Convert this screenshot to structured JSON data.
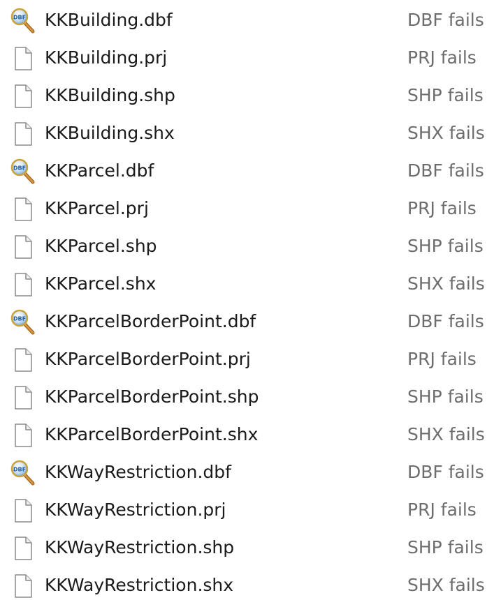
{
  "files": [
    {
      "name": "KKBuilding.dbf",
      "type": "DBF fails",
      "icon": "dbf-viewer-icon"
    },
    {
      "name": "KKBuilding.prj",
      "type": "PRJ fails",
      "icon": "blank-file-icon"
    },
    {
      "name": "KKBuilding.shp",
      "type": "SHP fails",
      "icon": "blank-file-icon"
    },
    {
      "name": "KKBuilding.shx",
      "type": "SHX fails",
      "icon": "blank-file-icon"
    },
    {
      "name": "KKParcel.dbf",
      "type": "DBF fails",
      "icon": "dbf-viewer-icon"
    },
    {
      "name": "KKParcel.prj",
      "type": "PRJ fails",
      "icon": "blank-file-icon"
    },
    {
      "name": "KKParcel.shp",
      "type": "SHP fails",
      "icon": "blank-file-icon"
    },
    {
      "name": "KKParcel.shx",
      "type": "SHX fails",
      "icon": "blank-file-icon"
    },
    {
      "name": "KKParcelBorderPoint.dbf",
      "type": "DBF fails",
      "icon": "dbf-viewer-icon"
    },
    {
      "name": "KKParcelBorderPoint.prj",
      "type": "PRJ fails",
      "icon": "blank-file-icon"
    },
    {
      "name": "KKParcelBorderPoint.shp",
      "type": "SHP fails",
      "icon": "blank-file-icon"
    },
    {
      "name": "KKParcelBorderPoint.shx",
      "type": "SHX fails",
      "icon": "blank-file-icon"
    },
    {
      "name": "KKWayRestriction.dbf",
      "type": "DBF fails",
      "icon": "dbf-viewer-icon"
    },
    {
      "name": "KKWayRestriction.prj",
      "type": "PRJ fails",
      "icon": "blank-file-icon"
    },
    {
      "name": "KKWayRestriction.shp",
      "type": "SHP fails",
      "icon": "blank-file-icon"
    },
    {
      "name": "KKWayRestriction.shx",
      "type": "SHX fails",
      "icon": "blank-file-icon"
    }
  ],
  "colors": {
    "name_text": "#1a1a1a",
    "type_text": "#6d6d6d",
    "background": "#ffffff"
  }
}
